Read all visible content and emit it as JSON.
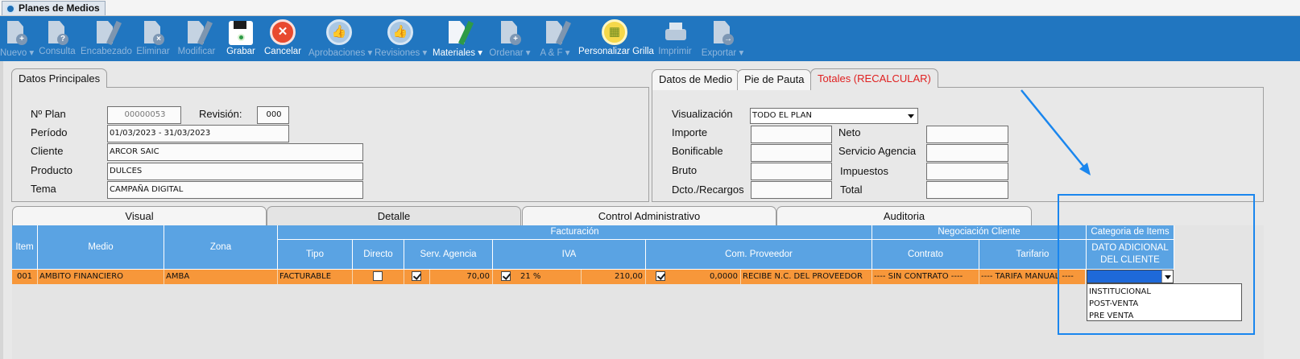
{
  "window": {
    "title": "Planes de Medios"
  },
  "toolbar": [
    {
      "label": "Nuevo ▾",
      "icon": "new-doc-icon",
      "enabled": false
    },
    {
      "label": "Consulta",
      "icon": "query-doc-icon",
      "enabled": false
    },
    {
      "label": "Encabezado",
      "icon": "edit-doc-icon",
      "enabled": false
    },
    {
      "label": "Eliminar",
      "icon": "delete-doc-icon",
      "enabled": false
    },
    {
      "label": "Modificar",
      "icon": "edit-doc-icon",
      "enabled": false
    },
    {
      "label": "Grabar",
      "icon": "save-icon",
      "enabled": true
    },
    {
      "label": "Cancelar",
      "icon": "cancel-icon",
      "enabled": true
    },
    {
      "label": "Aprobaciones ▾",
      "icon": "thumbs-up-icon",
      "enabled": false
    },
    {
      "label": "Revisiones ▾",
      "icon": "thumbs-up-icon",
      "enabled": false
    },
    {
      "label": "Materiales ▾",
      "icon": "materials-icon",
      "enabled": true
    },
    {
      "label": "Ordenar ▾",
      "icon": "order-doc-icon",
      "enabled": false
    },
    {
      "label": "A & F ▾",
      "icon": "af-doc-icon",
      "enabled": false
    },
    {
      "label": "Personalizar Grilla",
      "icon": "grid-icon",
      "enabled": true
    },
    {
      "label": "Imprimir",
      "icon": "printer-icon",
      "enabled": false
    },
    {
      "label": "Exportar ▾",
      "icon": "export-doc-icon",
      "enabled": false
    }
  ],
  "principal": {
    "tab": "Datos Principales",
    "plan_label": "Nº Plan",
    "plan_value": "00000053",
    "revision_label": "Revisión:",
    "revision_value": "000",
    "periodo_label": "Período",
    "periodo_value": "01/03/2023 - 31/03/2023",
    "cliente_label": "Cliente",
    "cliente_value": "ARCOR SAIC",
    "producto_label": "Producto",
    "producto_value": "DULCES",
    "tema_label": "Tema",
    "tema_value": "CAMPAÑA DIGITAL"
  },
  "totales": {
    "tabs": [
      "Datos de Medio",
      "Pie de Pauta",
      "Totales (RECALCULAR)"
    ],
    "visualizacion_label": "Visualización",
    "visualizacion_value": "TODO EL PLAN",
    "importe": "Importe",
    "neto": "Neto",
    "bonificable": "Bonificable",
    "servicio": "Servicio Agencia",
    "bruto": "Bruto",
    "impuestos": "Impuestos",
    "dcto": "Dcto./Recargos",
    "total": "Total"
  },
  "grid": {
    "tabs": [
      "Visual",
      "Detalle",
      "Control Administrativo",
      "Auditoria"
    ],
    "headers": {
      "item": "Item",
      "medio": "Medio",
      "zona": "Zona",
      "facturacion": "Facturación",
      "tipo": "Tipo",
      "directo": "Directo",
      "serv": "Serv. Agencia",
      "iva": "IVA",
      "com": "Com. Proveedor",
      "negociacion": "Negociación Cliente",
      "contrato": "Contrato",
      "tarifario": "Tarifario",
      "categoria": "Categoria de Items",
      "dato1": "DATO ADICIONAL",
      "dato2": "DEL CLIENTE"
    },
    "row": {
      "item": "001",
      "medio": "AMBITO FINANCIERO",
      "zona": "AMBA",
      "tipo": "FACTURABLE",
      "directo": false,
      "serv_checked": true,
      "serv_value": "70,00",
      "iva_checked": true,
      "iva_pct": "21 %",
      "iva_value": "210,00",
      "com_checked": true,
      "com_value": "0,0000",
      "com_text": "RECIBE N.C. DEL PROVEEDOR",
      "contrato": "---- SIN CONTRATO ----",
      "tarifario": "---- TARIFA MANUAL ----"
    },
    "dropdown_options": [
      "INSTITUCIONAL",
      "POST-VENTA",
      "PRE VENTA"
    ]
  },
  "colors": {
    "toolbar": "#2176c0",
    "header": "#5aa3e3",
    "row": "#f7973a",
    "highlight": "#1a86ee",
    "alert_tab": "#e02020"
  }
}
